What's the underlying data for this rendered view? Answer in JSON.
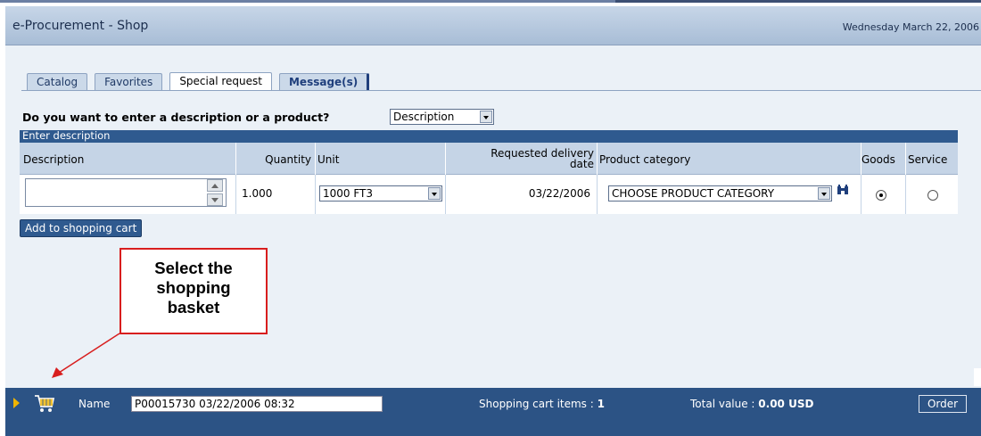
{
  "window": {
    "title": "e-Procurement - Shop",
    "date": "Wednesday  March 22, 2006"
  },
  "tabs": [
    {
      "label": "Catalog",
      "active": false
    },
    {
      "label": "Favorites",
      "active": false
    },
    {
      "label": "Special request",
      "active": true
    },
    {
      "label": "Message(s)",
      "active": false
    }
  ],
  "form": {
    "question": "Do you want to enter a description or a product?",
    "entry_mode": "Description"
  },
  "section": {
    "title": "Enter description"
  },
  "table": {
    "headers": {
      "description": "Description",
      "quantity": "Quantity",
      "unit": "Unit",
      "delivery_date": "Requested delivery date",
      "delivery_date_line1": "Requested delivery",
      "delivery_date_line2": "date",
      "product_category": "Product category",
      "goods": "Goods",
      "service": "Service"
    },
    "row": {
      "description": "",
      "quantity": "1.000",
      "unit": "1000 FT3",
      "delivery_date": "03/22/2006",
      "product_category": "CHOOSE PRODUCT CATEGORY",
      "type": "Goods"
    }
  },
  "buttons": {
    "add_to_cart": "Add to shopping cart",
    "order": "Order"
  },
  "callout": {
    "line1": "Select the",
    "line2": "shopping",
    "line3": "basket"
  },
  "footer": {
    "name_label": "Name",
    "name_value": "P00015730 03/22/2006 08:32",
    "items_label": "Shopping cart items : ",
    "items_count": "1",
    "total_label": "Total value : ",
    "total_value": "0.00 USD"
  },
  "icons": {
    "cart": "shopping-cart-icon",
    "search": "binoculars-icon",
    "expand": "triangle-right-icon"
  },
  "colors": {
    "header_blue": "#2f5a8f",
    "footer_blue": "#2c5385",
    "callout_red": "#d81e1e",
    "content_bg": "#ebf1f7"
  }
}
